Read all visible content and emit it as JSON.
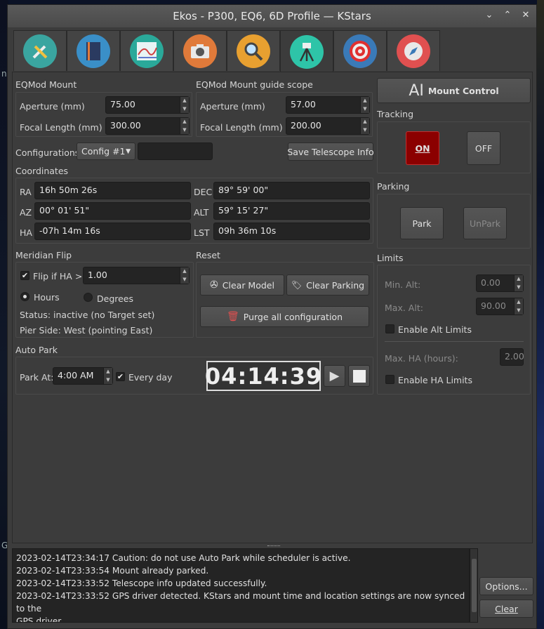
{
  "window": {
    "title": "Ekos - P300, EQ6, 6D Profile — KStars"
  },
  "desktop": {
    "left_letters": [
      "n",
      "G"
    ]
  },
  "tabs": [
    {
      "name": "setup",
      "icon": "tools-icon",
      "color": "#3aa5a0"
    },
    {
      "name": "notes",
      "icon": "notebook-icon",
      "color": "#3a8fc8"
    },
    {
      "name": "analyze",
      "icon": "graph-icon",
      "color": "#2aa99a"
    },
    {
      "name": "capture",
      "icon": "camera-icon",
      "color": "#e07a3a"
    },
    {
      "name": "focus",
      "icon": "magnifier-icon",
      "color": "#e8a030"
    },
    {
      "name": "mount",
      "icon": "telescope-tripod-icon",
      "color": "#2ec4a8",
      "active": true
    },
    {
      "name": "guide",
      "icon": "target-icon",
      "color": "#3a7ab8"
    },
    {
      "name": "align",
      "icon": "compass-icon",
      "color": "#e05050"
    }
  ],
  "scope": {
    "title": "EQMod Mount",
    "aperture_label": "Aperture (mm)",
    "aperture": "75.00",
    "focal_label": "Focal Length (mm)",
    "focal": "300.00"
  },
  "guide_scope": {
    "title": "EQMod Mount guide scope",
    "aperture_label": "Aperture (mm)",
    "aperture": "57.00",
    "focal_label": "Focal Length (mm)",
    "focal": "200.00"
  },
  "config": {
    "label": "Configurations",
    "selected": "Config #1",
    "save_label": "Save Telescope Info"
  },
  "coords": {
    "title": "Coordinates",
    "ra_label": "RA",
    "ra": "16h 50m 26s",
    "dec_label": "DEC",
    "dec": "89° 59' 00\"",
    "az_label": "AZ",
    "az": "00° 01' 51\"",
    "alt_label": "ALT",
    "alt": "59° 15' 27\"",
    "ha_label": "HA",
    "ha": "-07h 14m 16s",
    "lst_label": "LST",
    "lst": "09h 36m 10s"
  },
  "meridian": {
    "title": "Meridian Flip",
    "flip_label": "Flip if HA >",
    "flip_value": "1.00",
    "flip_checked": "✔",
    "hours_label": "Hours",
    "degrees_label": "Degrees",
    "status": "Status: inactive (no Target set)",
    "pier": "Pier Side: West (pointing East)"
  },
  "reset": {
    "title": "Reset",
    "clear_model": "Clear  Model",
    "clear_parking": "Clear Parking",
    "purge": "Purge all configuration"
  },
  "autopark": {
    "title": "Auto Park",
    "park_at_label": "Park At:",
    "park_at": "4:00 AM",
    "everyday_label": "Every day",
    "everyday_checked": "✔",
    "clock": "04:14:39"
  },
  "mount_control": {
    "label": "Mount Control"
  },
  "tracking": {
    "title": "Tracking",
    "on": "ON",
    "off": "OFF",
    "on_color": "#8b0000"
  },
  "parking": {
    "title": "Parking",
    "park": "Park",
    "unpark": "UnPark"
  },
  "limits": {
    "title": "Limits",
    "min_alt_label": "Min. Alt:",
    "min_alt": "0.00",
    "max_alt_label": "Max. Alt:",
    "max_alt": "90.00",
    "enable_alt": "Enable Alt Limits",
    "max_ha_label": "Max. HA (hours):",
    "max_ha": "2.00",
    "enable_ha": "Enable HA Limits"
  },
  "log": {
    "lines": [
      "2023-02-14T23:34:17 Caution: do not use Auto Park while scheduler is active.",
      "2023-02-14T23:33:54 Mount already parked.",
      "2023-02-14T23:33:52 Telescope info updated successfully.",
      "2023-02-14T23:33:52 GPS driver detected. KStars and mount time and location settings are now synced to the",
      "GPS driver."
    ],
    "options_label": "Options...",
    "clear_label": "Clear"
  }
}
